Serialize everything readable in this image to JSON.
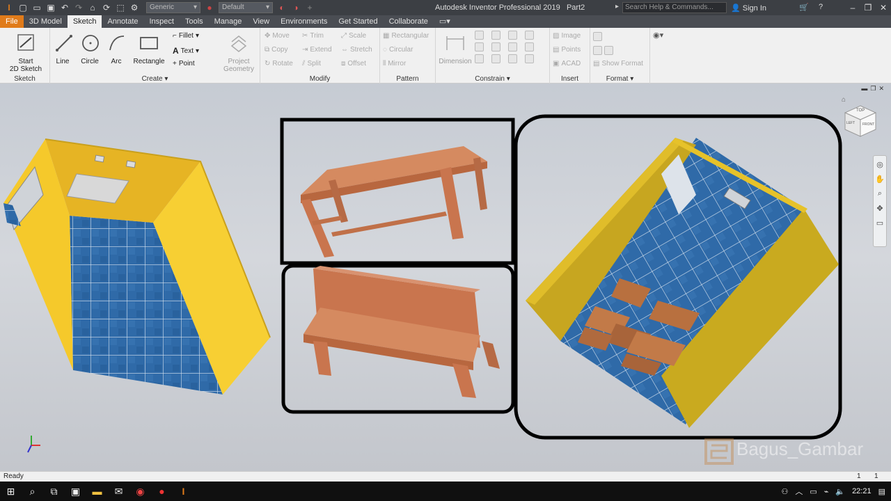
{
  "titlebar": {
    "title": "Autodesk Inventor Professional 2019",
    "document": "Part2",
    "material": "Generic",
    "appearance": "Default",
    "search_placeholder": "Search Help & Commands...",
    "signin": "Sign In"
  },
  "menu": {
    "tabs": [
      "File",
      "3D Model",
      "Sketch",
      "Annotate",
      "Inspect",
      "Tools",
      "Manage",
      "View",
      "Environments",
      "Get Started",
      "Collaborate"
    ]
  },
  "ribbon": {
    "sketch_panel": {
      "label": "Sketch",
      "start_line1": "Start",
      "start_line2": "2D Sketch"
    },
    "create_panel": {
      "label": "Create",
      "line": "Line",
      "circle": "Circle",
      "arc": "Arc",
      "rectangle": "Rectangle",
      "fillet": "Fillet",
      "text": "Text",
      "point": "Point"
    },
    "project_geometry": {
      "line1": "Project",
      "line2": "Geometry"
    },
    "modify_panel": {
      "label": "Modify",
      "move": "Move",
      "trim": "Trim",
      "scale": "Scale",
      "copy": "Copy",
      "extend": "Extend",
      "stretch": "Stretch",
      "rotate": "Rotate",
      "split": "Split",
      "offset": "Offset"
    },
    "pattern_panel": {
      "label": "Pattern",
      "rectangular": "Rectangular",
      "circular": "Circular",
      "mirror": "Mirror"
    },
    "constrain_panel": {
      "label": "Constrain",
      "dimension": "Dimension"
    },
    "insert_panel": {
      "label": "Insert",
      "image": "Image",
      "points": "Points",
      "acad": "ACAD"
    },
    "format_panel": {
      "label": "Format",
      "show_format": "Show Format"
    }
  },
  "viewcube": {
    "top": "TOP",
    "front": "FRONT",
    "left": "LEFT"
  },
  "watermark": "Bagus_Gambar",
  "status": {
    "text": "Ready",
    "count1": "1",
    "count2": "1"
  },
  "taskbar": {
    "time": "22:21"
  },
  "colors": {
    "accent": "#e07b1a",
    "wall": "#f5c92b",
    "tile": "#2f6aa8",
    "wood": "#c9754e"
  }
}
